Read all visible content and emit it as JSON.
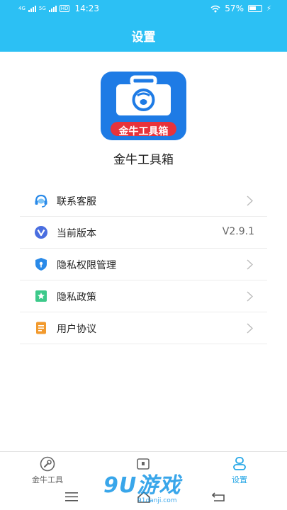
{
  "status_bar": {
    "network_left": "4G",
    "network_right": "5G",
    "hd_badge": "HD",
    "time": "14:23",
    "battery": "57%"
  },
  "header": {
    "title": "设置"
  },
  "app": {
    "name": "金牛工具箱",
    "logo_text": "金牛工具箱"
  },
  "menu": {
    "items": [
      {
        "label": "联系客服",
        "icon": "headset-icon"
      },
      {
        "label": "当前版本",
        "icon": "version-v-icon",
        "value": "V2.9.1"
      },
      {
        "label": "隐私权限管理",
        "icon": "privacy-shield-icon"
      },
      {
        "label": "隐私政策",
        "icon": "policy-star-icon"
      },
      {
        "label": "用户协议",
        "icon": "agreement-doc-icon"
      }
    ]
  },
  "tabbar": {
    "tabs": [
      {
        "label": "金牛工具",
        "icon": "wrench-circle-icon",
        "active": false
      },
      {
        "label": "",
        "icon": "tool-box-icon",
        "active": false
      },
      {
        "label": "设置",
        "icon": "settings-person-icon",
        "active": true
      }
    ]
  },
  "watermark": {
    "main": "9U游戏",
    "sub": "91danji.com"
  },
  "colors": {
    "header_bg": "#2cc0f4",
    "active_tab": "#23a6e6",
    "logo_blue": "#1e7be5",
    "logo_red": "#e8333b"
  }
}
